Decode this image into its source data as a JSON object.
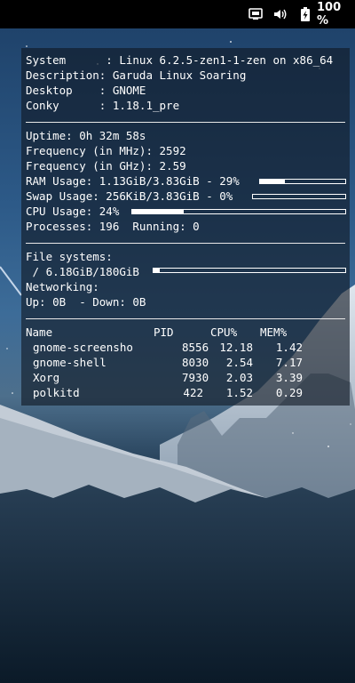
{
  "topbar": {
    "network_icon": "network-monitor-icon",
    "volume_icon": "volume-icon",
    "battery_icon": "battery-charging-icon",
    "battery_percent": "100 %"
  },
  "conky": {
    "system_lines": [
      "System      : Linux 6.2.5-zen1-1-zen on x86_64",
      "Description: Garuda Linux Soaring",
      "Desktop    : GNOME",
      "Conky      : 1.18.1_pre"
    ],
    "uptime": "Uptime: 0h 32m 58s",
    "freq_mhz": "Frequency (in MHz): 2592",
    "freq_ghz": "Frequency (in GHz): 2.59",
    "ram": {
      "label": "RAM Usage: 1.13GiB/3.83GiB - 29%",
      "percent": 29
    },
    "swap": {
      "label": "Swap Usage: 256KiB/3.83GiB - 0%",
      "percent": 0
    },
    "cpu": {
      "label": "CPU Usage: 24%",
      "percent": 24
    },
    "processes": "Processes: 196  Running: 0",
    "filesystems_header": "File systems:",
    "root_fs": {
      "label": " / 6.18GiB/180GiB",
      "percent": 3.4
    },
    "networking_header": "Networking:",
    "net_speed": "Up: 0B  - Down: 0B",
    "process_table": {
      "headers": [
        "Name",
        "PID",
        "CPU%",
        "MEM%"
      ],
      "rows": [
        [
          "gnome-screensho",
          "8556",
          "12.18",
          "1.42"
        ],
        [
          "gnome-shell",
          "8030",
          "2.54",
          "7.17"
        ],
        [
          "Xorg",
          "7930",
          "2.03",
          "3.39"
        ],
        [
          "polkitd",
          "422",
          "1.52",
          "0.29"
        ]
      ]
    }
  }
}
